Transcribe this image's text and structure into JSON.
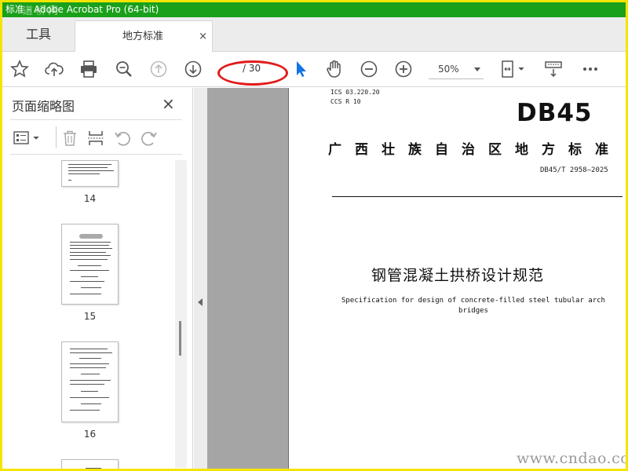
{
  "window": {
    "title": "标准 - Adobe Acrobat Pro (64-bit)",
    "watermark_top": "道桥网"
  },
  "tabs": {
    "tools_label": "工具",
    "document_label": "地方标准",
    "close_glyph": "×"
  },
  "toolbar": {
    "current_page": "",
    "page_total": "/ 30",
    "zoom_value": "50%"
  },
  "sidebar": {
    "title": "页面缩略图",
    "close_glyph": "×",
    "thumbnails": [
      {
        "label": "14"
      },
      {
        "label": "15"
      },
      {
        "label": "16"
      }
    ]
  },
  "document": {
    "ics_line": "ICS  03.220.20",
    "ccs_line": "CCS  R 10",
    "logo": "DB45",
    "region": "广西壮族自治区地方标准",
    "standard_number": "DB45/T 2958—2025",
    "title_cn": "钢管混凝土拱桥设计规范",
    "title_en": "Specification for design of concrete-filled steel tubular arch bridges"
  },
  "watermark": "www.cndao.com",
  "colors": {
    "titlebar_bg": "#1aa01a",
    "frame_border": "#f5e400",
    "annotation_ellipse": "#e21a1a",
    "select_tool_blue": "#1473e6"
  }
}
